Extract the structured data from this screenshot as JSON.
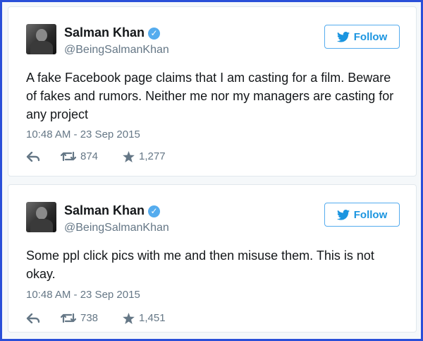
{
  "tweets": [
    {
      "name": "Salman Khan",
      "handle": "@BeingSalmanKhan",
      "follow_label": "Follow",
      "text": "A fake Facebook page claims that I am casting for a film. Beware of fakes and rumors. Neither me nor my managers are casting for any project",
      "timestamp": "10:48 AM - 23 Sep 2015",
      "retweets": "874",
      "likes": "1,277"
    },
    {
      "name": "Salman Khan",
      "handle": "@BeingSalmanKhan",
      "follow_label": "Follow",
      "text": "Some ppl click pics with me and then misuse them. This is not okay.",
      "timestamp": "10:48 AM - 23 Sep 2015",
      "retweets": "738",
      "likes": "1,451"
    }
  ],
  "colors": {
    "frame_border": "#2a4fd8",
    "accent": "#1b95e0",
    "verified": "#55acee",
    "muted": "#657786"
  },
  "icons": [
    "verified-badge-icon",
    "twitter-bird-icon",
    "reply-icon",
    "retweet-icon",
    "like-star-icon"
  ]
}
